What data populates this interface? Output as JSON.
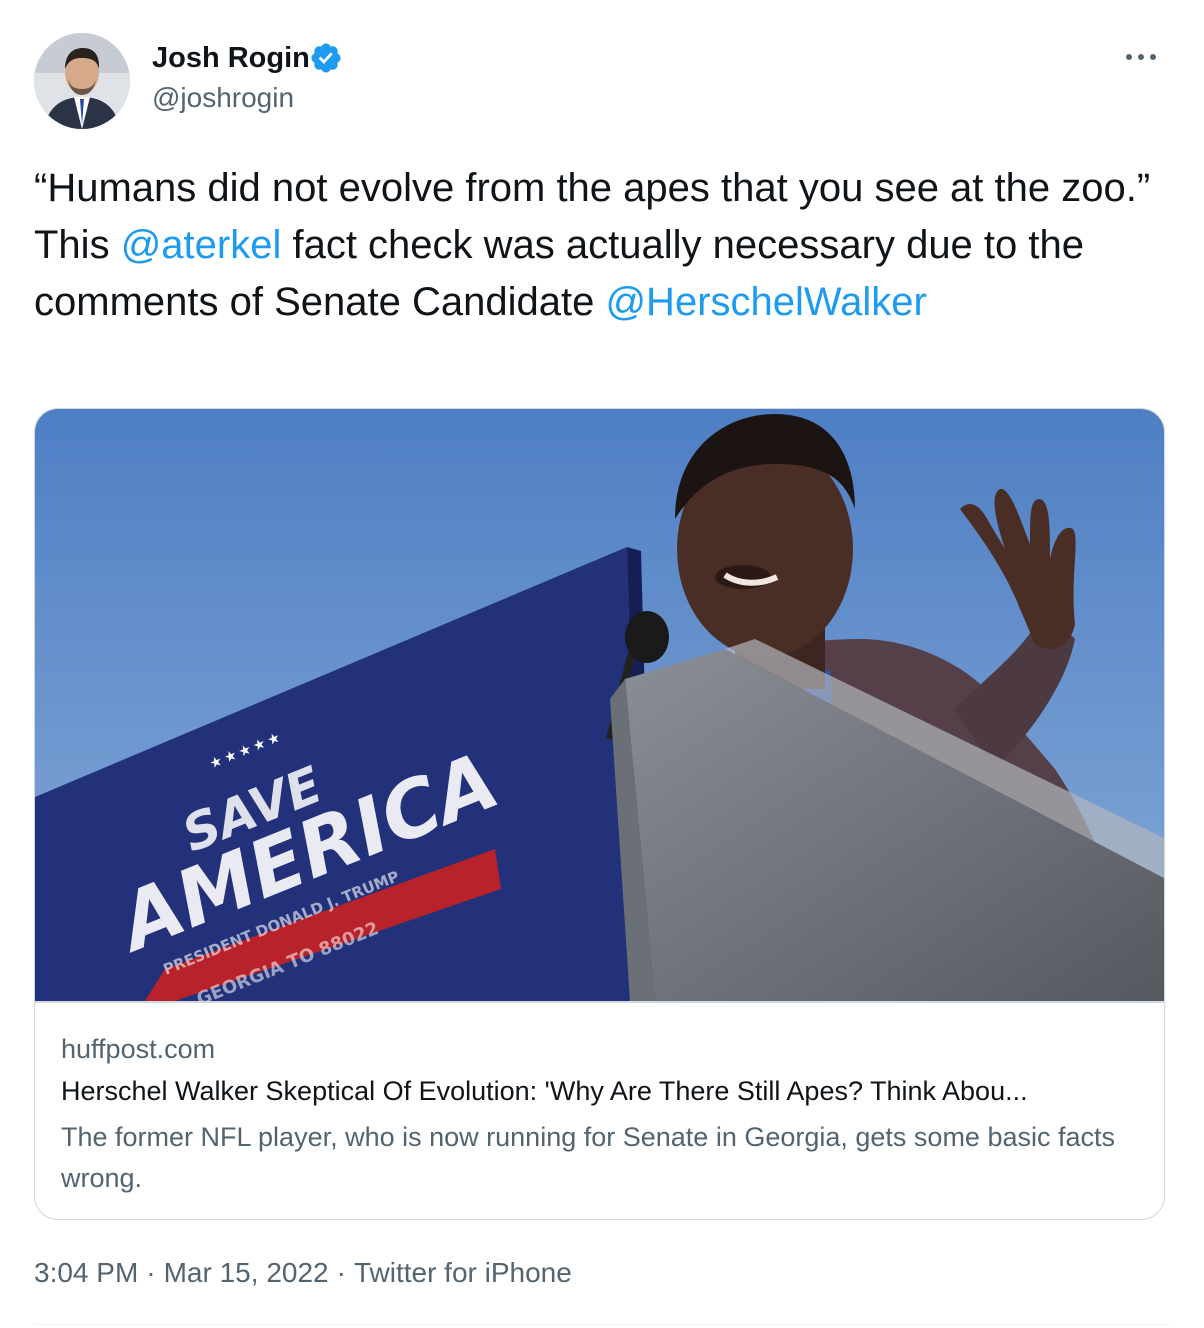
{
  "author": {
    "display_name": "Josh Rogin",
    "handle": "@joshrogin",
    "verified": true,
    "avatar_icon": "profile-avatar"
  },
  "tweet": {
    "text_parts": [
      "“Humans did not evolve from the apes that you see at the zoo.” This ",
      "@aterkel",
      " fact check was actually necessary due to the comments of Senate Candidate ",
      "@HerschelWalker"
    ],
    "time": "3:04 PM",
    "date": "Mar 15, 2022",
    "source": "Twitter for iPhone",
    "separator": "·"
  },
  "card": {
    "domain": "huffpost.com",
    "title": "Herschel Walker Skeptical Of Evolution: 'Why Are There Still Apes? Think Abou...",
    "description": "The former NFL player, who is now running for Senate in Georgia, gets some basic facts wrong.",
    "image_texts": {
      "save": "SAVE",
      "america": "AMERICA",
      "president": "PRESIDENT DONALD J. TRUMP",
      "georgia": "GEORGIA TO 88022",
      "stars": "★★★★★"
    }
  },
  "colors": {
    "link": "#1d9bf0",
    "secondary_text": "#536471",
    "verified_badge": "#1d9bf0",
    "border": "#cfd9de"
  },
  "icons": {
    "more": "more-horizontal-icon",
    "verified": "verified-badge-icon"
  }
}
